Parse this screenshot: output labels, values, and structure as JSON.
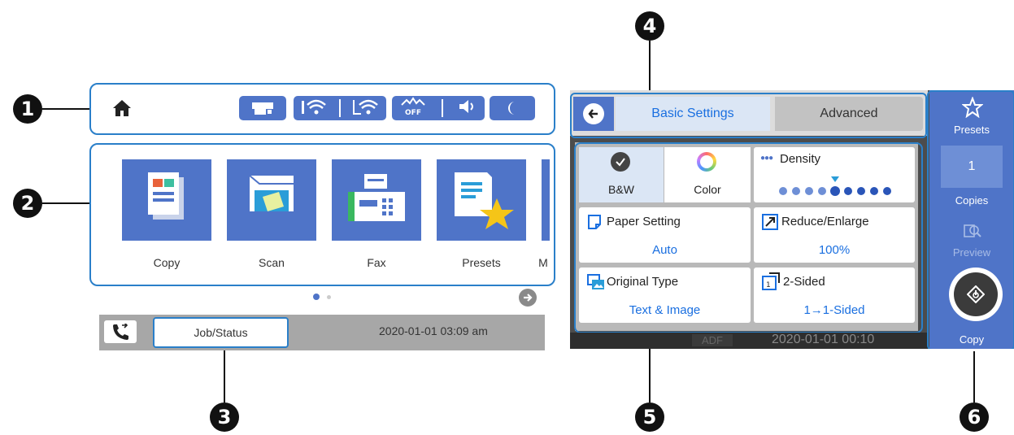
{
  "callouts": [
    "1",
    "2",
    "3",
    "4",
    "5",
    "6"
  ],
  "home_screen": {
    "status_icons": [
      "home-icon",
      "printer-icon",
      "wifi-direct-icon",
      "wifi-icon",
      "eco-off-icon",
      "volume-icon",
      "sleep-icon"
    ],
    "apps": [
      {
        "label": "Copy",
        "icon": "copy-icon"
      },
      {
        "label": "Scan",
        "icon": "scan-icon"
      },
      {
        "label": "Fax",
        "icon": "fax-icon"
      },
      {
        "label": "Presets",
        "icon": "presets-icon"
      },
      {
        "label": "M",
        "icon": "more-app-icon"
      }
    ],
    "job_status_label": "Job/Status",
    "datetime": "2020-01-01 03:09 am"
  },
  "copy_screen": {
    "tabs": {
      "basic": "Basic Settings",
      "advanced": "Advanced"
    },
    "bw_label": "B&W",
    "color_label": "Color",
    "density_label": "Density",
    "density_level": 5,
    "density_max": 9,
    "paper_setting": {
      "label": "Paper Setting",
      "value": "Auto"
    },
    "reduce_enlarge": {
      "label": "Reduce/Enlarge",
      "value": "100%"
    },
    "original_type": {
      "label": "Original Type",
      "value": "Text & Image"
    },
    "two_sided": {
      "label": "2-Sided",
      "value": "1→1-Sided"
    },
    "adf_label": "ADF",
    "datetime": "2020-01-01 00:10",
    "side": {
      "presets": "Presets",
      "copies_value": "1",
      "copies": "Copies",
      "preview": "Preview",
      "copy": "Copy"
    }
  },
  "colors": {
    "accent": "#2a7fc9",
    "tile_blue": "#4f74c8",
    "value_blue": "#1a6fe0"
  }
}
